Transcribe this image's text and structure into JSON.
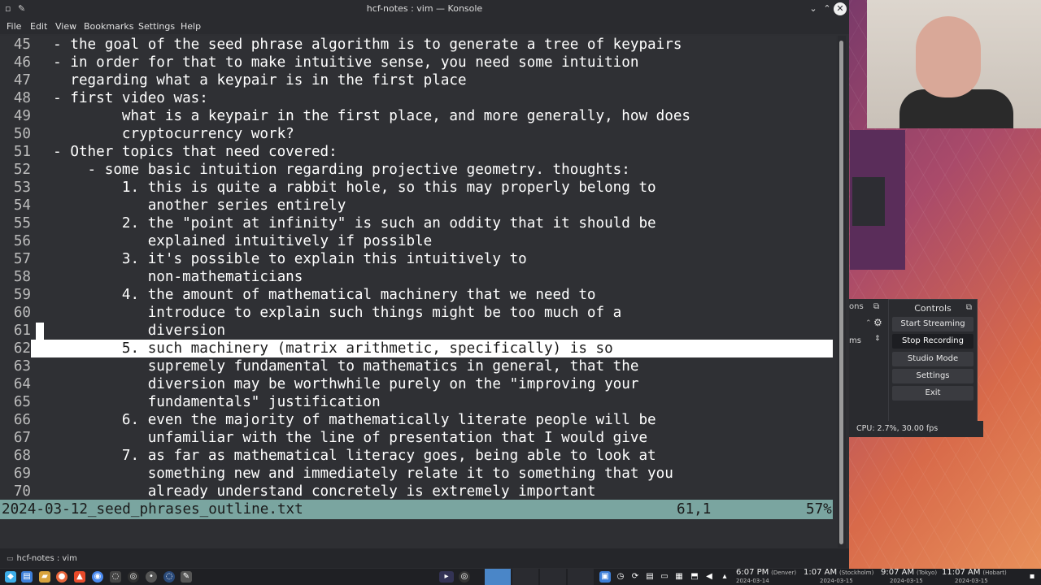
{
  "window": {
    "title": "hcf-notes : vim — Konsole",
    "left_icons": [
      "▫",
      "✎"
    ],
    "controls": [
      "⌄",
      "⌃",
      "✕"
    ]
  },
  "menu": [
    "File",
    "Edit",
    "View",
    "Bookmarks",
    "Settings",
    "Help"
  ],
  "editor": {
    "lines": [
      {
        "num": "45",
        "text": "  - the goal of the seed phrase algorithm is to generate a tree of keypairs"
      },
      {
        "num": "46",
        "text": "  - in order for that to make intuitive sense, you need some intuition"
      },
      {
        "num": "47",
        "text": "    regarding what a keypair is in the first place"
      },
      {
        "num": "48",
        "text": "  - first video was:"
      },
      {
        "num": "49",
        "text": "          what is a keypair in the first place, and more generally, how does"
      },
      {
        "num": "50",
        "text": "          cryptocurrency work?"
      },
      {
        "num": "51",
        "text": "  - Other topics that need covered:"
      },
      {
        "num": "52",
        "text": "      - some basic intuition regarding projective geometry. thoughts:"
      },
      {
        "num": "53",
        "text": "          1. this is quite a rabbit hole, so this may properly belong to"
      },
      {
        "num": "54",
        "text": "             another series entirely"
      },
      {
        "num": "55",
        "text": "          2. the \"point at infinity\" is such an oddity that it should be"
      },
      {
        "num": "56",
        "text": "             explained intuitively if possible"
      },
      {
        "num": "57",
        "text": "          3. it's possible to explain this intuitively to"
      },
      {
        "num": "58",
        "text": "             non-mathematicians"
      },
      {
        "num": "59",
        "text": "          4. the amount of mathematical machinery that we need to"
      },
      {
        "num": "60",
        "text": "             introduce to explain such things might be too much of a"
      },
      {
        "num": "61",
        "text": "             diversion"
      },
      {
        "num": "62",
        "text": "          5. such machinery (matrix arithmetic, specifically) is so"
      },
      {
        "num": "63",
        "text": "             supremely fundamental to mathematics in general, that the"
      },
      {
        "num": "64",
        "text": "             diversion may be worthwhile purely on the \"improving your"
      },
      {
        "num": "65",
        "text": "             fundamentals\" justification"
      },
      {
        "num": "66",
        "text": "          6. even the majority of mathematically literate people will be"
      },
      {
        "num": "67",
        "text": "             unfamiliar with the line of presentation that I would give"
      },
      {
        "num": "68",
        "text": "          7. as far as mathematical literacy goes, being able to look at"
      },
      {
        "num": "69",
        "text": "             something new and immediately relate it to something that you"
      },
      {
        "num": "70",
        "text": "             already understand concretely is extremely important"
      }
    ],
    "highlighted_line": "62",
    "status": {
      "filename": "2024-03-12_seed_phrases_outline.txt",
      "position": "61,1",
      "percent": "57%"
    }
  },
  "tab": {
    "label": "hcf-notes : vim"
  },
  "obs": {
    "left_dock_title": "ons",
    "left_dock_text": "ms",
    "controls_title": "Controls",
    "buttons": [
      "Start Streaming",
      "Stop Recording",
      "Studio Mode",
      "Settings",
      "Exit"
    ],
    "active_button": "Stop Recording",
    "cpu": "CPU: 2.7%, 30.00 fps"
  },
  "taskbar": {
    "clocks": [
      {
        "time": "6:07 PM",
        "zone": "(Denver)",
        "date": "2024-03-14"
      },
      {
        "time": "1:07 AM",
        "zone": "(Stockholm)",
        "date": "2024-03-15"
      },
      {
        "time": "9:07 AM",
        "zone": "(Tokyo)",
        "date": "2024-03-15"
      },
      {
        "time": "11:07 AM",
        "zone": "(Hobart)",
        "date": "2024-03-15"
      }
    ],
    "icons": [
      "app-launcher-icon",
      "files-icon",
      "folder-icon",
      "firefox-icon",
      "brave-icon",
      "chrome-icon",
      "obs-icon",
      "dot-icon",
      "spinner-icon",
      "editor-icon"
    ],
    "accent": "#3daee9"
  }
}
